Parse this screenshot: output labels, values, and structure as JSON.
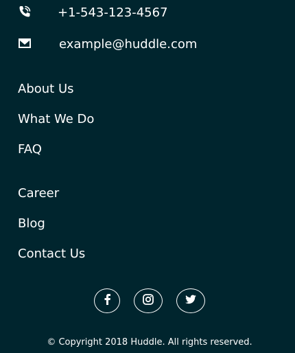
{
  "contact": {
    "phone": "+1-543-123-4567",
    "email": "example@huddle.com",
    "phone_icon": "phone-icon",
    "email_icon": "mail-icon"
  },
  "nav_primary": [
    {
      "label": "About Us"
    },
    {
      "label": "What We Do"
    },
    {
      "label": "FAQ"
    }
  ],
  "nav_secondary": [
    {
      "label": "Career"
    },
    {
      "label": "Blog"
    },
    {
      "label": "Contact Us"
    }
  ],
  "social": [
    {
      "name": "facebook",
      "icon": "facebook-icon"
    },
    {
      "name": "instagram",
      "icon": "instagram-icon"
    },
    {
      "name": "twitter",
      "icon": "twitter-icon"
    }
  ],
  "footer": {
    "copyright": "© Copyright 2018 Huddle. All rights reserved."
  },
  "colors": {
    "background": "#00252e",
    "text": "#ffffff"
  }
}
